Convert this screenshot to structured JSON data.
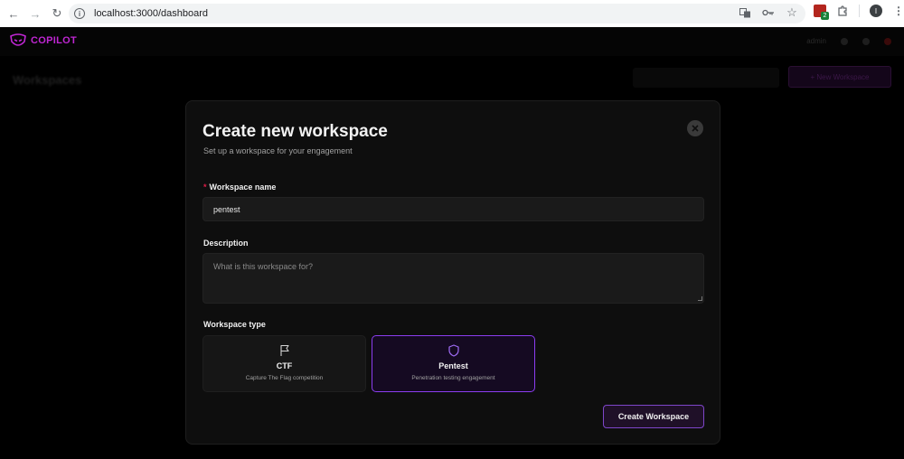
{
  "browser": {
    "url": "localhost:3000/dashboard",
    "extension_badge": "2",
    "profile_initial": "I"
  },
  "app": {
    "brand": "COPILOT",
    "page_title": "Workspaces",
    "new_workspace_label": "+ New Workspace",
    "user_label": "admin"
  },
  "modal": {
    "title": "Create new workspace",
    "subtitle": "Set up a workspace for your engagement",
    "name_label": "Workspace name",
    "name_required_mark": "*",
    "name_value": "pentest",
    "description_label": "Description",
    "description_placeholder": "What is this workspace for?",
    "type_label": "Workspace type",
    "types": [
      {
        "title": "CTF",
        "description": "Capture The Flag competition",
        "icon": "flag-icon",
        "selected": false
      },
      {
        "title": "Pentest",
        "description": "Penetration testing engagement",
        "icon": "shield-icon",
        "selected": true
      }
    ],
    "submit_label": "Create Workspace"
  },
  "colors": {
    "brand": "#c026d3",
    "accent": "#8b3df0",
    "required": "#e11d48"
  }
}
